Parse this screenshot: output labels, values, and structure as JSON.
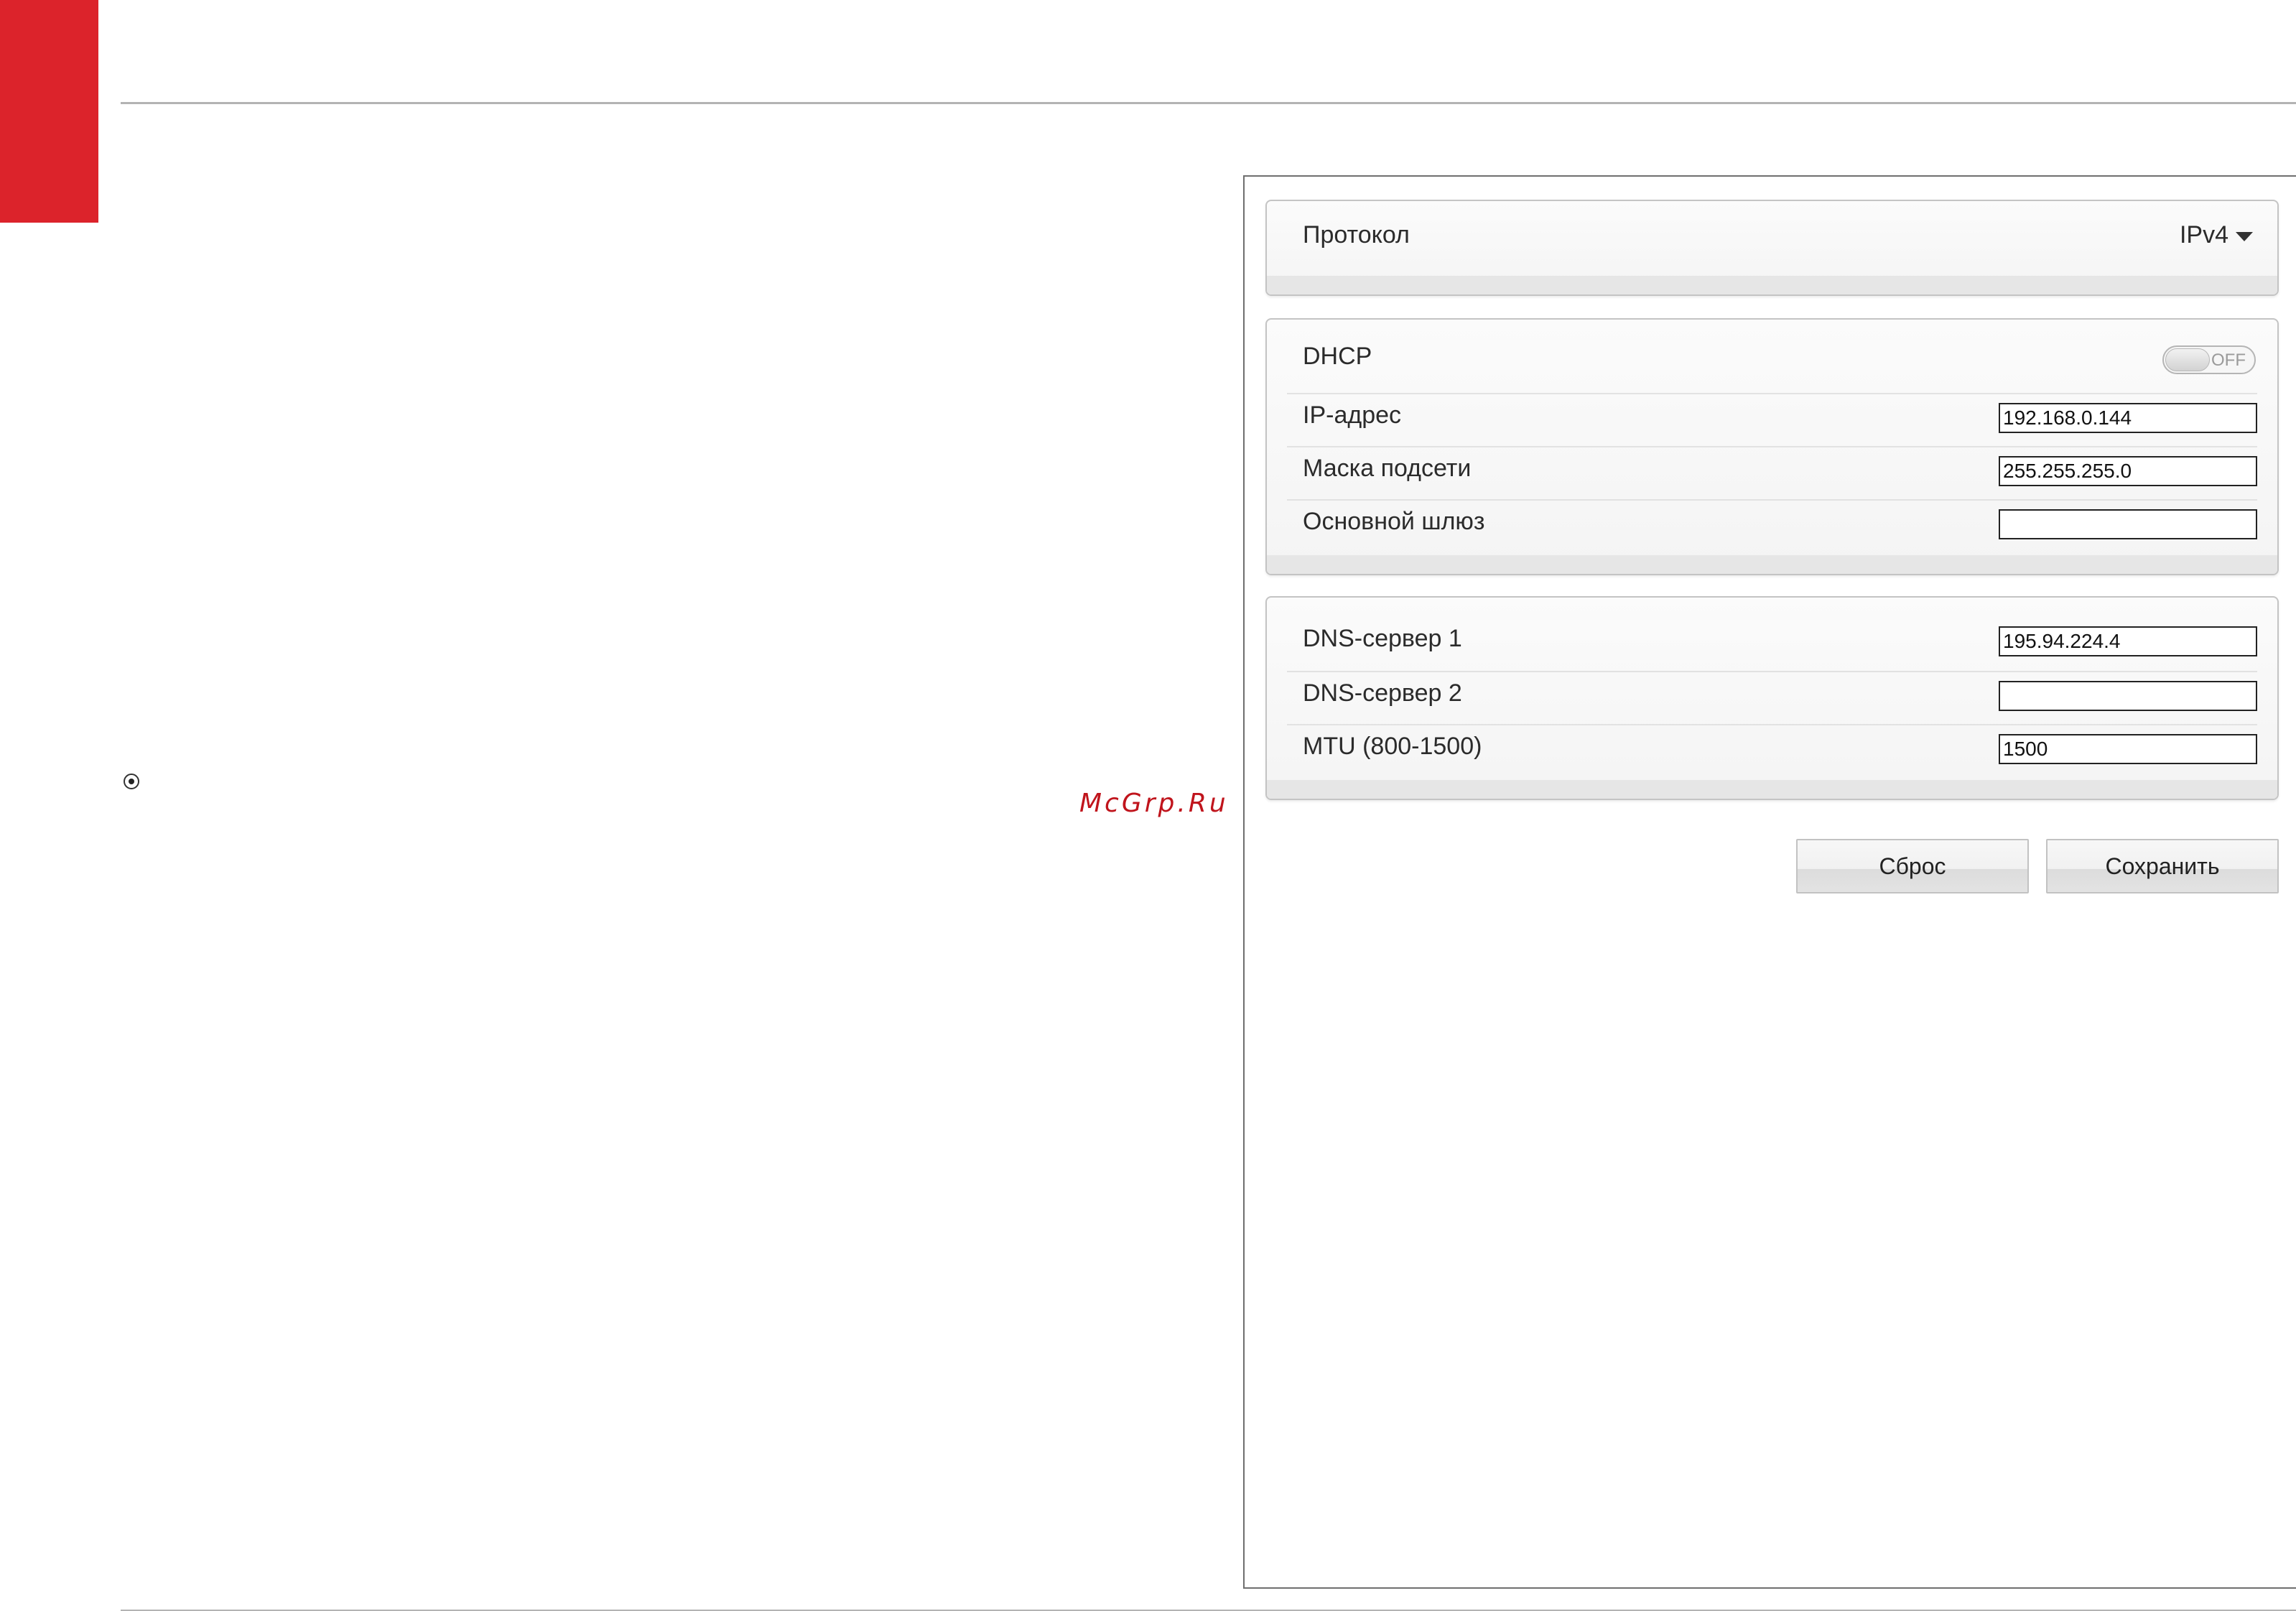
{
  "watermark": "McGrp.Ru",
  "protocol_panel": {
    "label": "Протокол",
    "selected": "IPv4"
  },
  "ip_panel": {
    "dhcp": {
      "label": "DHCP",
      "state": "OFF"
    },
    "ip_address": {
      "label": "IP-адрес",
      "value": "192.168.0.144"
    },
    "subnet_mask": {
      "label": "Маска подсети",
      "value": "255.255.255.0"
    },
    "gateway": {
      "label": "Основной шлюз",
      "value": ""
    }
  },
  "dns_panel": {
    "dns1": {
      "label": "DNS-сервер 1",
      "value": "195.94.224.4"
    },
    "dns2": {
      "label": "DNS-сервер 2",
      "value": ""
    },
    "mtu": {
      "label": "MTU (800-1500)",
      "value": "1500"
    }
  },
  "buttons": {
    "reset_label": "Сброс",
    "save_label": "Сохранить"
  },
  "colors": {
    "accent_red": "#dc232b",
    "watermark_red": "#c0141c"
  }
}
